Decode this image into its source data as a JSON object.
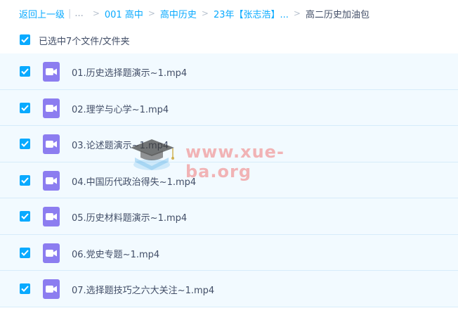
{
  "breadcrumb": {
    "back": "返回上一级",
    "ellipsis": "...",
    "items": [
      "001 高中",
      "高中历史",
      "23年【张志浩】..."
    ],
    "current": "高二历史加油包"
  },
  "selection": {
    "text": "已选中7个文件/文件夹"
  },
  "files": [
    {
      "name": "01.历史选择题演示~1.mp4",
      "checked": true,
      "icon": "video-file-icon"
    },
    {
      "name": "02.理学与心学~1.mp4",
      "checked": true,
      "icon": "video-file-icon"
    },
    {
      "name": "03.论述题演示~1.mp4",
      "checked": true,
      "icon": "video-file-icon"
    },
    {
      "name": "04.中国历代政治得失~1.mp4",
      "checked": true,
      "icon": "video-file-icon"
    },
    {
      "name": "05.历史材料题演示~1.mp4",
      "checked": true,
      "icon": "video-file-icon"
    },
    {
      "name": "06.党史专题~1.mp4",
      "checked": true,
      "icon": "video-file-icon"
    },
    {
      "name": "07.选择题技巧之六大关注~1.mp4",
      "checked": true,
      "icon": "video-file-icon"
    }
  ],
  "watermark": {
    "text": "www.xue-ba.org"
  },
  "colors": {
    "accent": "#09aaff",
    "row_bg": "#f2faff",
    "row_border": "#d6ecfa",
    "video_icon": "#8c7df0",
    "text": "#424e67"
  }
}
